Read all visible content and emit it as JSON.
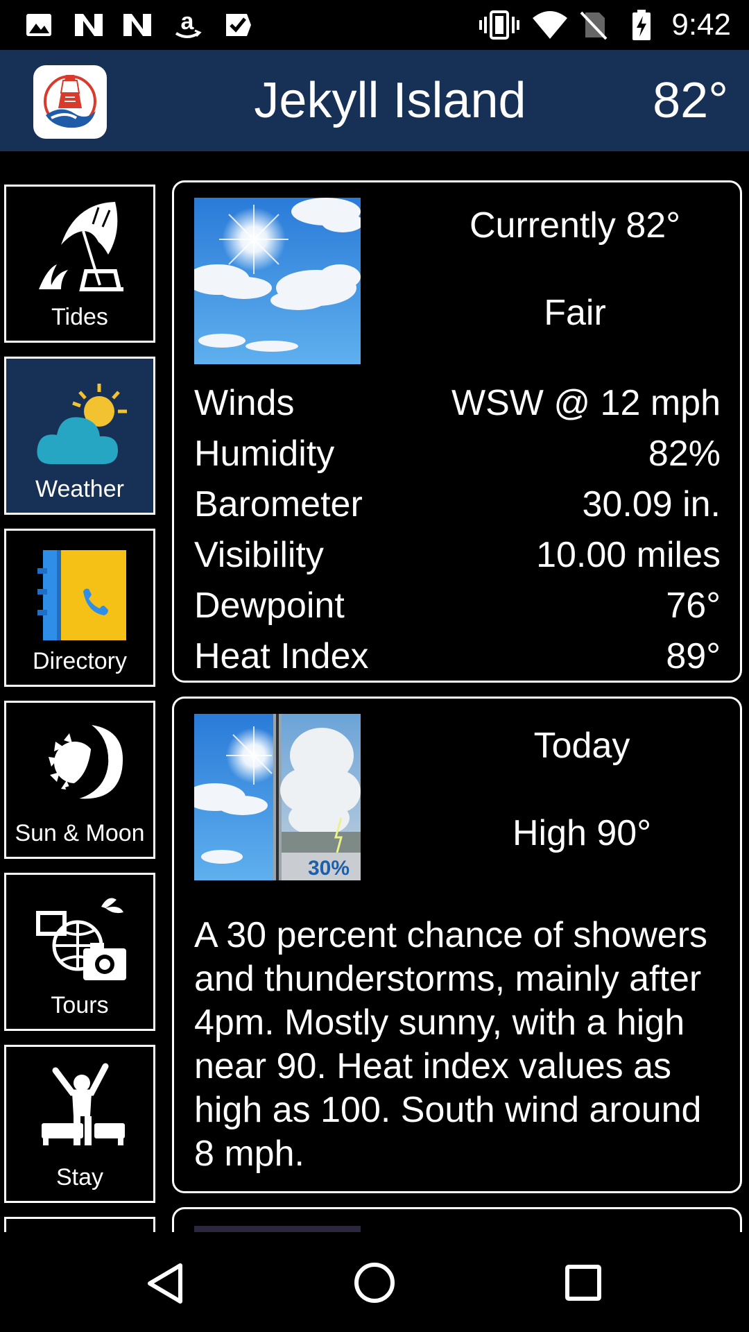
{
  "status_bar": {
    "time": "9:42",
    "left_icons": [
      "image-icon",
      "n-icon",
      "n-icon",
      "amazon-icon",
      "checkbox-icon"
    ],
    "right_icons": [
      "vibrate-icon",
      "wifi-icon",
      "no-sim-icon",
      "battery-charging-icon"
    ]
  },
  "header": {
    "title": "Jekyll Island",
    "temperature": "82°",
    "background_color": "#173056"
  },
  "nav": {
    "items": [
      {
        "label": "Tides",
        "icon": "beach-umbrella-icon",
        "active": false
      },
      {
        "label": "Weather",
        "icon": "cloud-sun-icon",
        "active": true
      },
      {
        "label": "Directory",
        "icon": "phone-book-icon",
        "active": false
      },
      {
        "label": "Sun & Moon",
        "icon": "sun-moon-icon",
        "active": false
      },
      {
        "label": "Tours",
        "icon": "globe-camera-icon",
        "active": false
      },
      {
        "label": "Stay",
        "icon": "person-bed-icon",
        "active": false
      }
    ]
  },
  "current": {
    "heading": "Currently 82°",
    "condition": "Fair",
    "rows": [
      {
        "label": "Winds",
        "value": "WSW @ 12 mph"
      },
      {
        "label": "Humidity",
        "value": "82%"
      },
      {
        "label": "Barometer",
        "value": "30.09 in."
      },
      {
        "label": "Visibility",
        "value": "10.00 miles"
      },
      {
        "label": "Dewpoint",
        "value": "76°"
      },
      {
        "label": "Heat Index",
        "value": "89°"
      }
    ]
  },
  "forecast": {
    "period": "Today",
    "high": "High 90°",
    "precip_chance": "30%",
    "description": "A 30 percent chance of showers and thunderstorms, mainly after 4pm.  Mostly sunny, with a high near 90. Heat index values as high as 100. South wind around 8 mph."
  },
  "system_nav": {
    "icons": [
      "back-icon",
      "home-icon",
      "recents-icon"
    ]
  }
}
